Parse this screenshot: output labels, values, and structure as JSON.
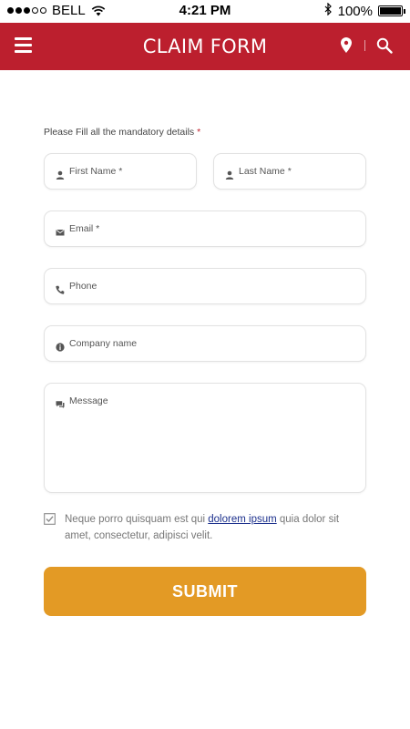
{
  "status_bar": {
    "carrier": "BELL",
    "time": "4:21 PM",
    "battery": "100%",
    "battery_level": 1.0,
    "signal_bars_filled": 3,
    "signal_bars_total": 5
  },
  "header": {
    "title": "CLAIM FORM",
    "background": "#bc1f2e",
    "icons": [
      "menu-icon",
      "location-pin-icon",
      "search-icon"
    ]
  },
  "form": {
    "intro": "Please Fill all the mandatory details",
    "required_mark": "*",
    "fields": {
      "first_name": {
        "placeholder": "First Name *",
        "icon": "user-icon"
      },
      "last_name": {
        "placeholder": "Last Name *",
        "icon": "user-icon"
      },
      "email": {
        "placeholder": "Email *",
        "icon": "envelope-icon"
      },
      "phone": {
        "placeholder": "Phone",
        "icon": "phone-icon"
      },
      "company": {
        "placeholder": "Company name",
        "icon": "info-icon"
      },
      "message": {
        "placeholder": "Message",
        "icon": "chat-icon"
      }
    },
    "agreement": {
      "before": "Neque porro quisquam est qui ",
      "link": "dolorem ipsum",
      "after": " quia dolor sit amet, consectetur, adipisci velit.",
      "checked": true
    },
    "submit_label": "SUBMIT",
    "submit_color": "#e39a25"
  }
}
